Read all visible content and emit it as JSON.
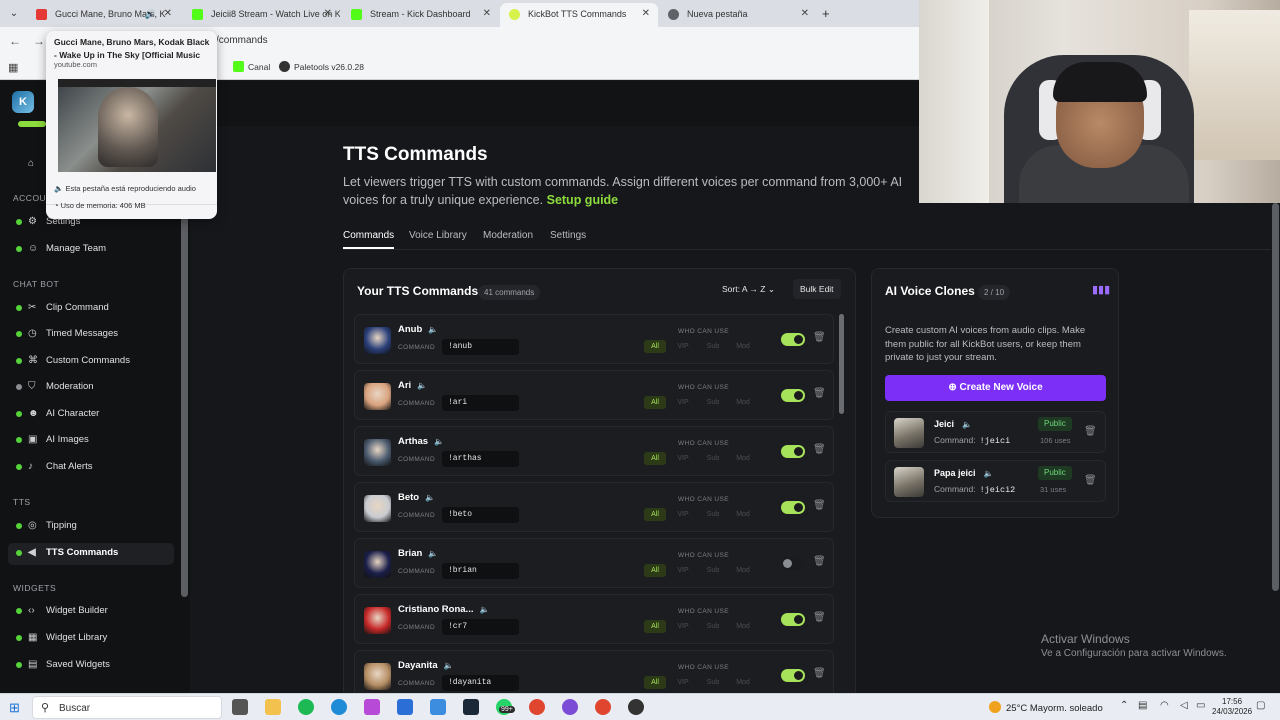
{
  "browser": {
    "tabs": [
      {
        "title": "Gucci Mane, Bruno Mars, K",
        "color": "#e53935"
      },
      {
        "title": "Jeicii8 Stream - Watch Live on K",
        "color": "#53fc18"
      },
      {
        "title": "Stream - Kick Dashboard",
        "color": "#53fc18"
      },
      {
        "title": "KickBot TTS Commands",
        "color": "#d7f24a"
      },
      {
        "title": "Nueva pestaña",
        "color": "#5f6368"
      }
    ],
    "url": "/commands",
    "bookmarks": [
      {
        "label": "Canal",
        "color": "#53fc18"
      },
      {
        "label": "Paletools v26.0.28",
        "color": "#333333"
      }
    ],
    "hovercard": {
      "title": "Gucci Mane, Bruno Mars, Kodak Black - Wake Up in The Sky [Official Music",
      "domain": "youtube.com",
      "audio_note": "Esta pestaña está reproduciendo audio",
      "memory": "Uso de memoria: 406 MB"
    }
  },
  "sidebar": {
    "brand": "K",
    "sections": {
      "account": "ACCOUNT",
      "chatbot": "CHAT BOT",
      "tts": "TTS",
      "widgets": "WIDGETS"
    },
    "items": [
      {
        "label": "Settings"
      },
      {
        "label": "Manage Team"
      },
      {
        "label": "Clip Command"
      },
      {
        "label": "Timed Messages"
      },
      {
        "label": "Custom Commands"
      },
      {
        "label": "Moderation"
      },
      {
        "label": "AI Character"
      },
      {
        "label": "AI Images"
      },
      {
        "label": "Chat Alerts"
      },
      {
        "label": "Tipping"
      },
      {
        "label": "TTS Commands"
      },
      {
        "label": "Widget Builder"
      },
      {
        "label": "Widget Library"
      },
      {
        "label": "Saved Widgets"
      }
    ]
  },
  "page": {
    "title": "TTS Commands",
    "description": "Let viewers trigger TTS with custom commands. Assign different voices per command from 3,000+ AI voices for a truly unique experience.",
    "setup_link": "Setup guide",
    "tabs": [
      "Commands",
      "Voice Library",
      "Moderation",
      "Settings"
    ]
  },
  "commands": {
    "heading": "Your TTS Commands",
    "count": "41 commands",
    "sort": "Sort: A → Z",
    "bulk_edit": "Bulk Edit",
    "command_label": "COMMAND",
    "who_label": "WHO CAN USE",
    "roles": [
      "All",
      "VIP",
      "Sub",
      "Mod"
    ],
    "rows": [
      {
        "name": "Anub",
        "command": "!anub",
        "enabled": true,
        "avatar": "#2a3f7a"
      },
      {
        "name": "Ari",
        "command": "!ari",
        "enabled": true,
        "avatar": "#d9a27e"
      },
      {
        "name": "Arthas",
        "command": "!arthas",
        "enabled": true,
        "avatar": "#4a5a6e"
      },
      {
        "name": "Beto",
        "command": "!beto",
        "enabled": true,
        "avatar": "#c9ccd1"
      },
      {
        "name": "Brian",
        "command": "!brian",
        "enabled": false,
        "avatar": "#1b1f4a"
      },
      {
        "name": "Cristiano Rona...",
        "command": "!cr7",
        "enabled": true,
        "avatar": "#c62828"
      },
      {
        "name": "Dayanita",
        "command": "!dayanita",
        "enabled": true,
        "avatar": "#b58d63"
      }
    ]
  },
  "voice_clones": {
    "title": "AI Voice Clones",
    "count": "2 / 10",
    "description": "Create custom AI voices from audio clips. Make them public for all KickBot users, or keep them private to just your stream.",
    "create_button": "Create New Voice",
    "command_label": "Command:",
    "items": [
      {
        "name": "Jeici",
        "command": "!jeici",
        "visibility": "Public",
        "uses": "106 uses"
      },
      {
        "name": "Papa jeici",
        "command": "!jeici2",
        "visibility": "Public",
        "uses": "31 uses"
      }
    ]
  },
  "windows": {
    "activate_title": "Activar Windows",
    "activate_sub": "Ve a Configuración para activar Windows."
  },
  "taskbar": {
    "search": "Buscar",
    "badge": "99+",
    "weather": "25°C  Mayorm. soleado",
    "time": "17:56",
    "date": "24/03/2026"
  }
}
